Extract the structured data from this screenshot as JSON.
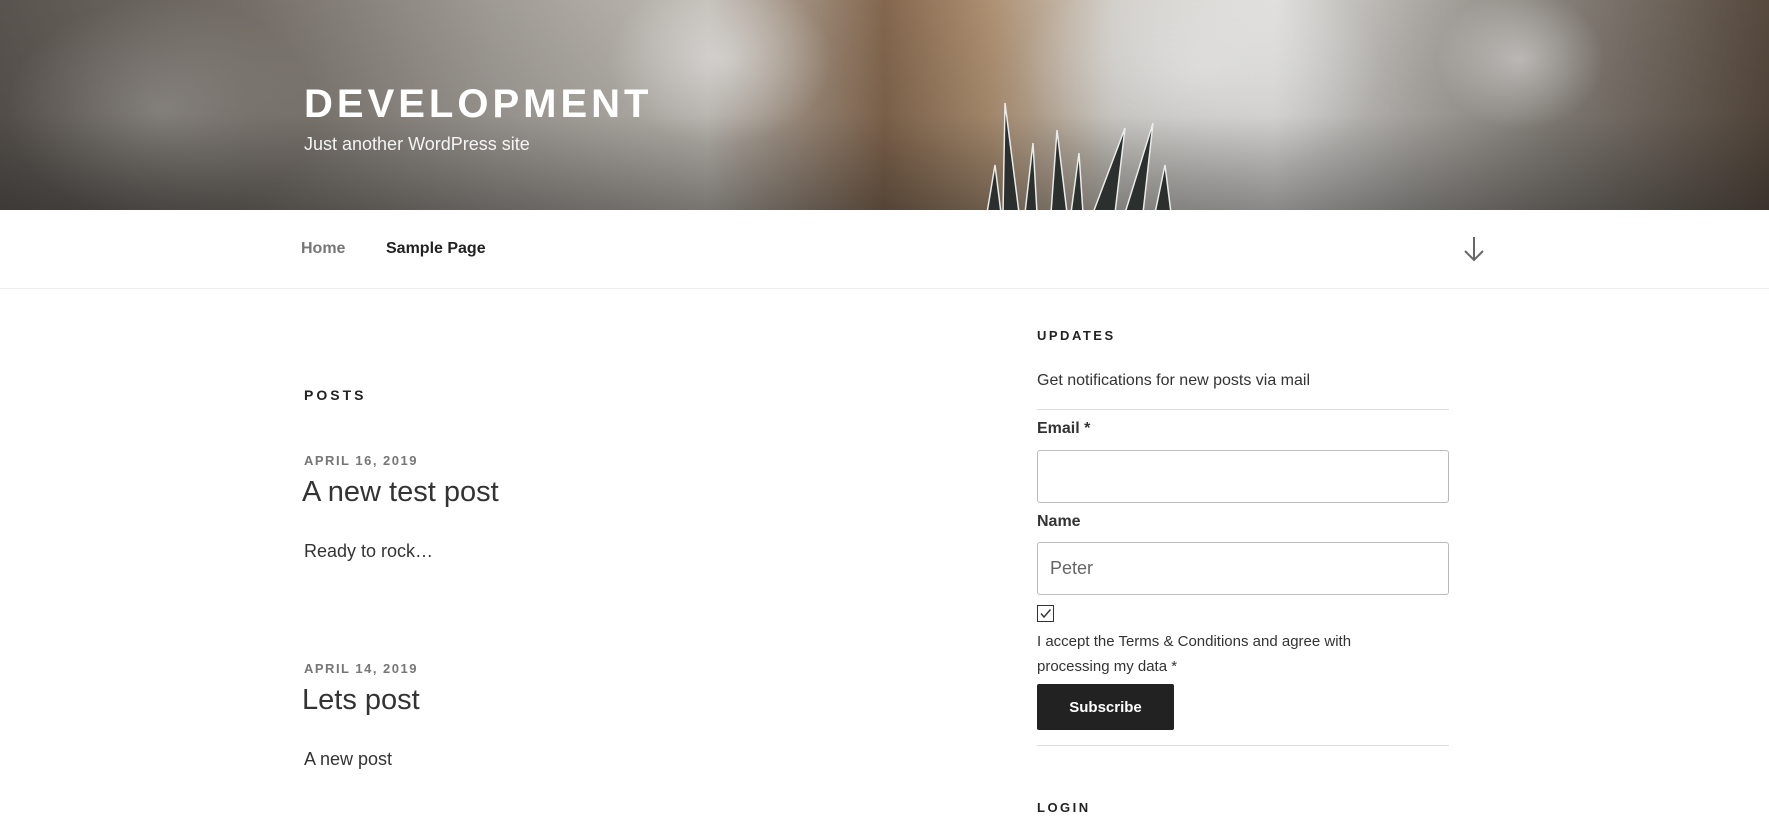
{
  "site": {
    "title": "DEVELOPMENT",
    "tagline": "Just another WordPress site"
  },
  "nav": {
    "items": [
      {
        "label": "Home",
        "state": "current"
      },
      {
        "label": "Sample Page"
      }
    ],
    "scroll_icon": "arrow-down-icon"
  },
  "posts": {
    "heading": "POSTS",
    "items": [
      {
        "date": "APRIL 16, 2019",
        "title": "A new test post",
        "excerpt": "Ready to rock…"
      },
      {
        "date": "APRIL 14, 2019",
        "title": "Lets post",
        "excerpt": "A new post"
      }
    ]
  },
  "sidebar": {
    "updates": {
      "title": "UPDATES",
      "description": "Get notifications for new posts via mail",
      "email_label": "Email *",
      "email_value": "",
      "name_label": "Name",
      "name_placeholder": "Peter",
      "consent_checked": true,
      "consent_text": "I accept the Terms & Conditions and agree with processing my data *",
      "subscribe_label": "Subscribe"
    },
    "login": {
      "title": "LOGIN"
    }
  },
  "colors": {
    "text": "#222222",
    "muted": "#767676",
    "button_bg": "#222222",
    "button_text": "#ffffff",
    "divider": "#dddddd"
  }
}
